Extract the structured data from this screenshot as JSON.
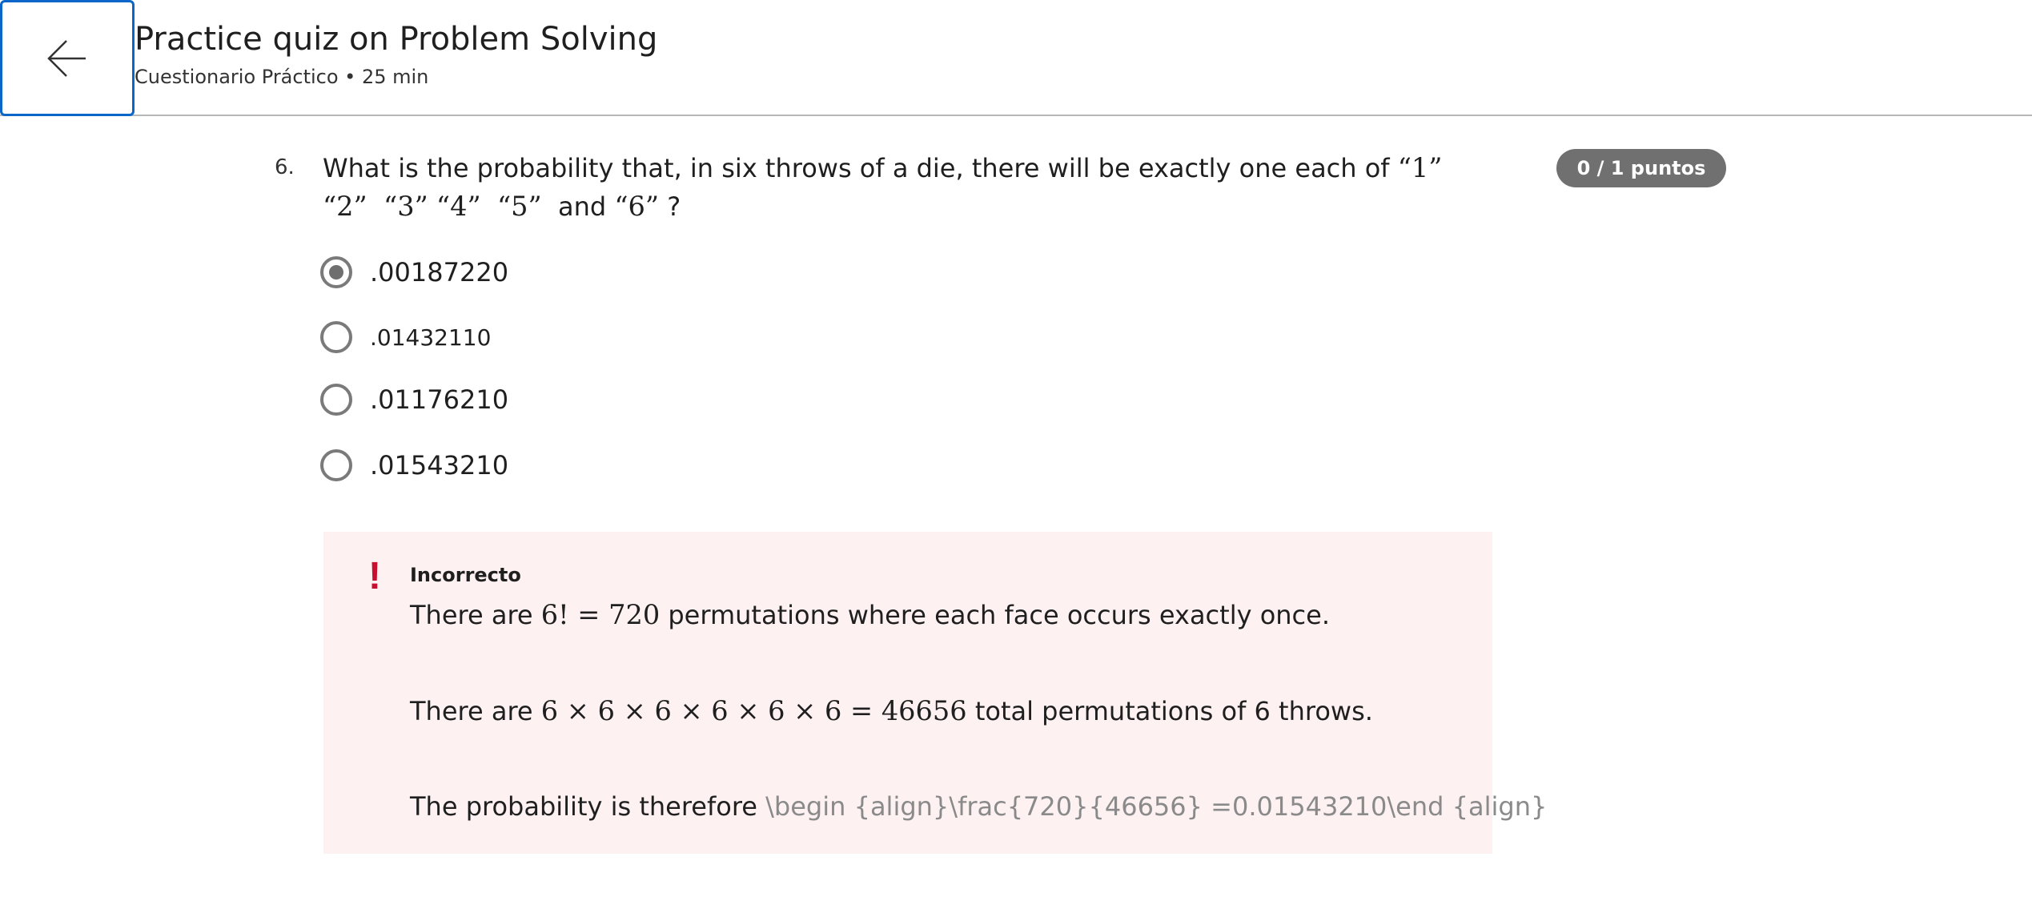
{
  "header": {
    "title": "Practice quiz on Problem Solving",
    "subtitle": "Cuestionario Práctico • 25 min"
  },
  "question": {
    "number": "6.",
    "text_prefix": "What is the probability that, in six throws of a die, there will be exactly one each of",
    "faces": [
      "“1”",
      "“2”",
      "“3”",
      "“4”",
      "“5”"
    ],
    "and_word": "and",
    "last_face": "“6”",
    "question_mark": "?",
    "score": "0 / 1 puntos"
  },
  "options": [
    {
      "label": ".00187220",
      "selected": true
    },
    {
      "label": ".01432110",
      "selected": false
    },
    {
      "label": ".01176210",
      "selected": false
    },
    {
      "label": ".01543210",
      "selected": false
    }
  ],
  "feedback": {
    "icon": "exclamation-icon",
    "status": "Incorrecto",
    "line1_prefix": "There are",
    "line1_math": "6! = 720",
    "line1_suffix": "permutations where each face occurs exactly once.",
    "line2_prefix": "There are",
    "line2_math": "6 × 6 × 6 × 6 × 6 × 6 = 46656",
    "line2_suffix": "total permutations of 6 throws.",
    "line3_prefix": "The probability is therefore",
    "line3_latex": "\\begin {align}\\frac{720}{46656} =0.01543210\\end {align}"
  },
  "colors": {
    "accent": "#0a66c8",
    "error": "#c8102e",
    "feedback_bg": "#fdf1f2",
    "badge_bg": "#707070"
  }
}
